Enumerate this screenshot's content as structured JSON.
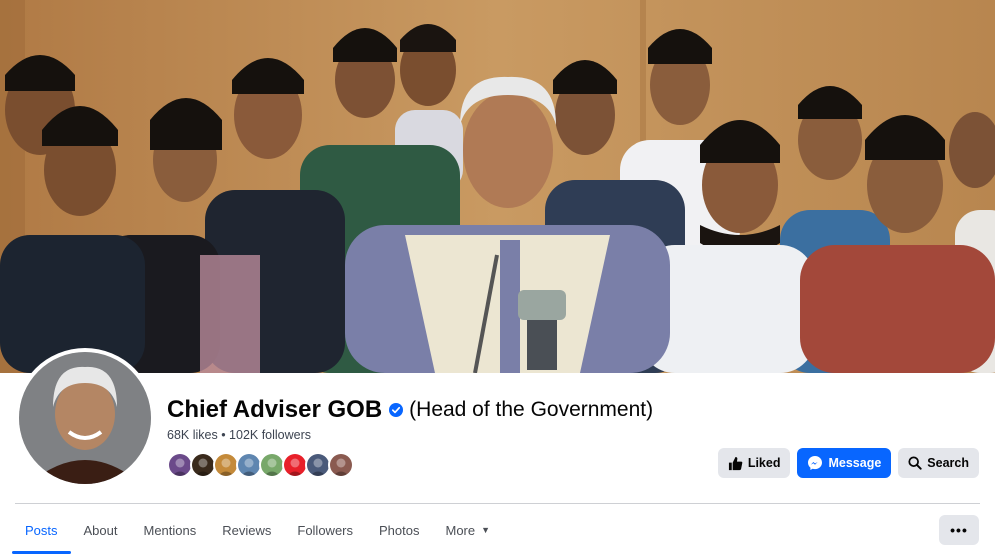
{
  "page": {
    "name": "Chief Adviser GOB",
    "category": "(Head of the Government)",
    "stats": "68K likes • 102K followers"
  },
  "cover": {
    "description_icon": "group-photo"
  },
  "profile_picture": {
    "icon": "profile-avatar"
  },
  "friend_avatars": [
    {
      "color": "#6b4a8a"
    },
    {
      "color": "#3a2a1c"
    },
    {
      "color": "#c48a3a"
    },
    {
      "color": "#5f86b0"
    },
    {
      "color": "#78a86a"
    },
    {
      "color": "#e8202a"
    },
    {
      "color": "#4a5a7a"
    },
    {
      "color": "#8a5a50"
    }
  ],
  "actions": {
    "liked_label": "Liked",
    "message_label": "Message",
    "search_label": "Search"
  },
  "tabs": [
    {
      "label": "Posts",
      "active": true
    },
    {
      "label": "About"
    },
    {
      "label": "Mentions"
    },
    {
      "label": "Reviews"
    },
    {
      "label": "Followers"
    },
    {
      "label": "Photos"
    },
    {
      "label": "More"
    }
  ],
  "more_menu_label": "•••",
  "colors": {
    "accent": "#0866ff",
    "button_grey": "#e4e6eb",
    "verified": "#0866ff"
  }
}
